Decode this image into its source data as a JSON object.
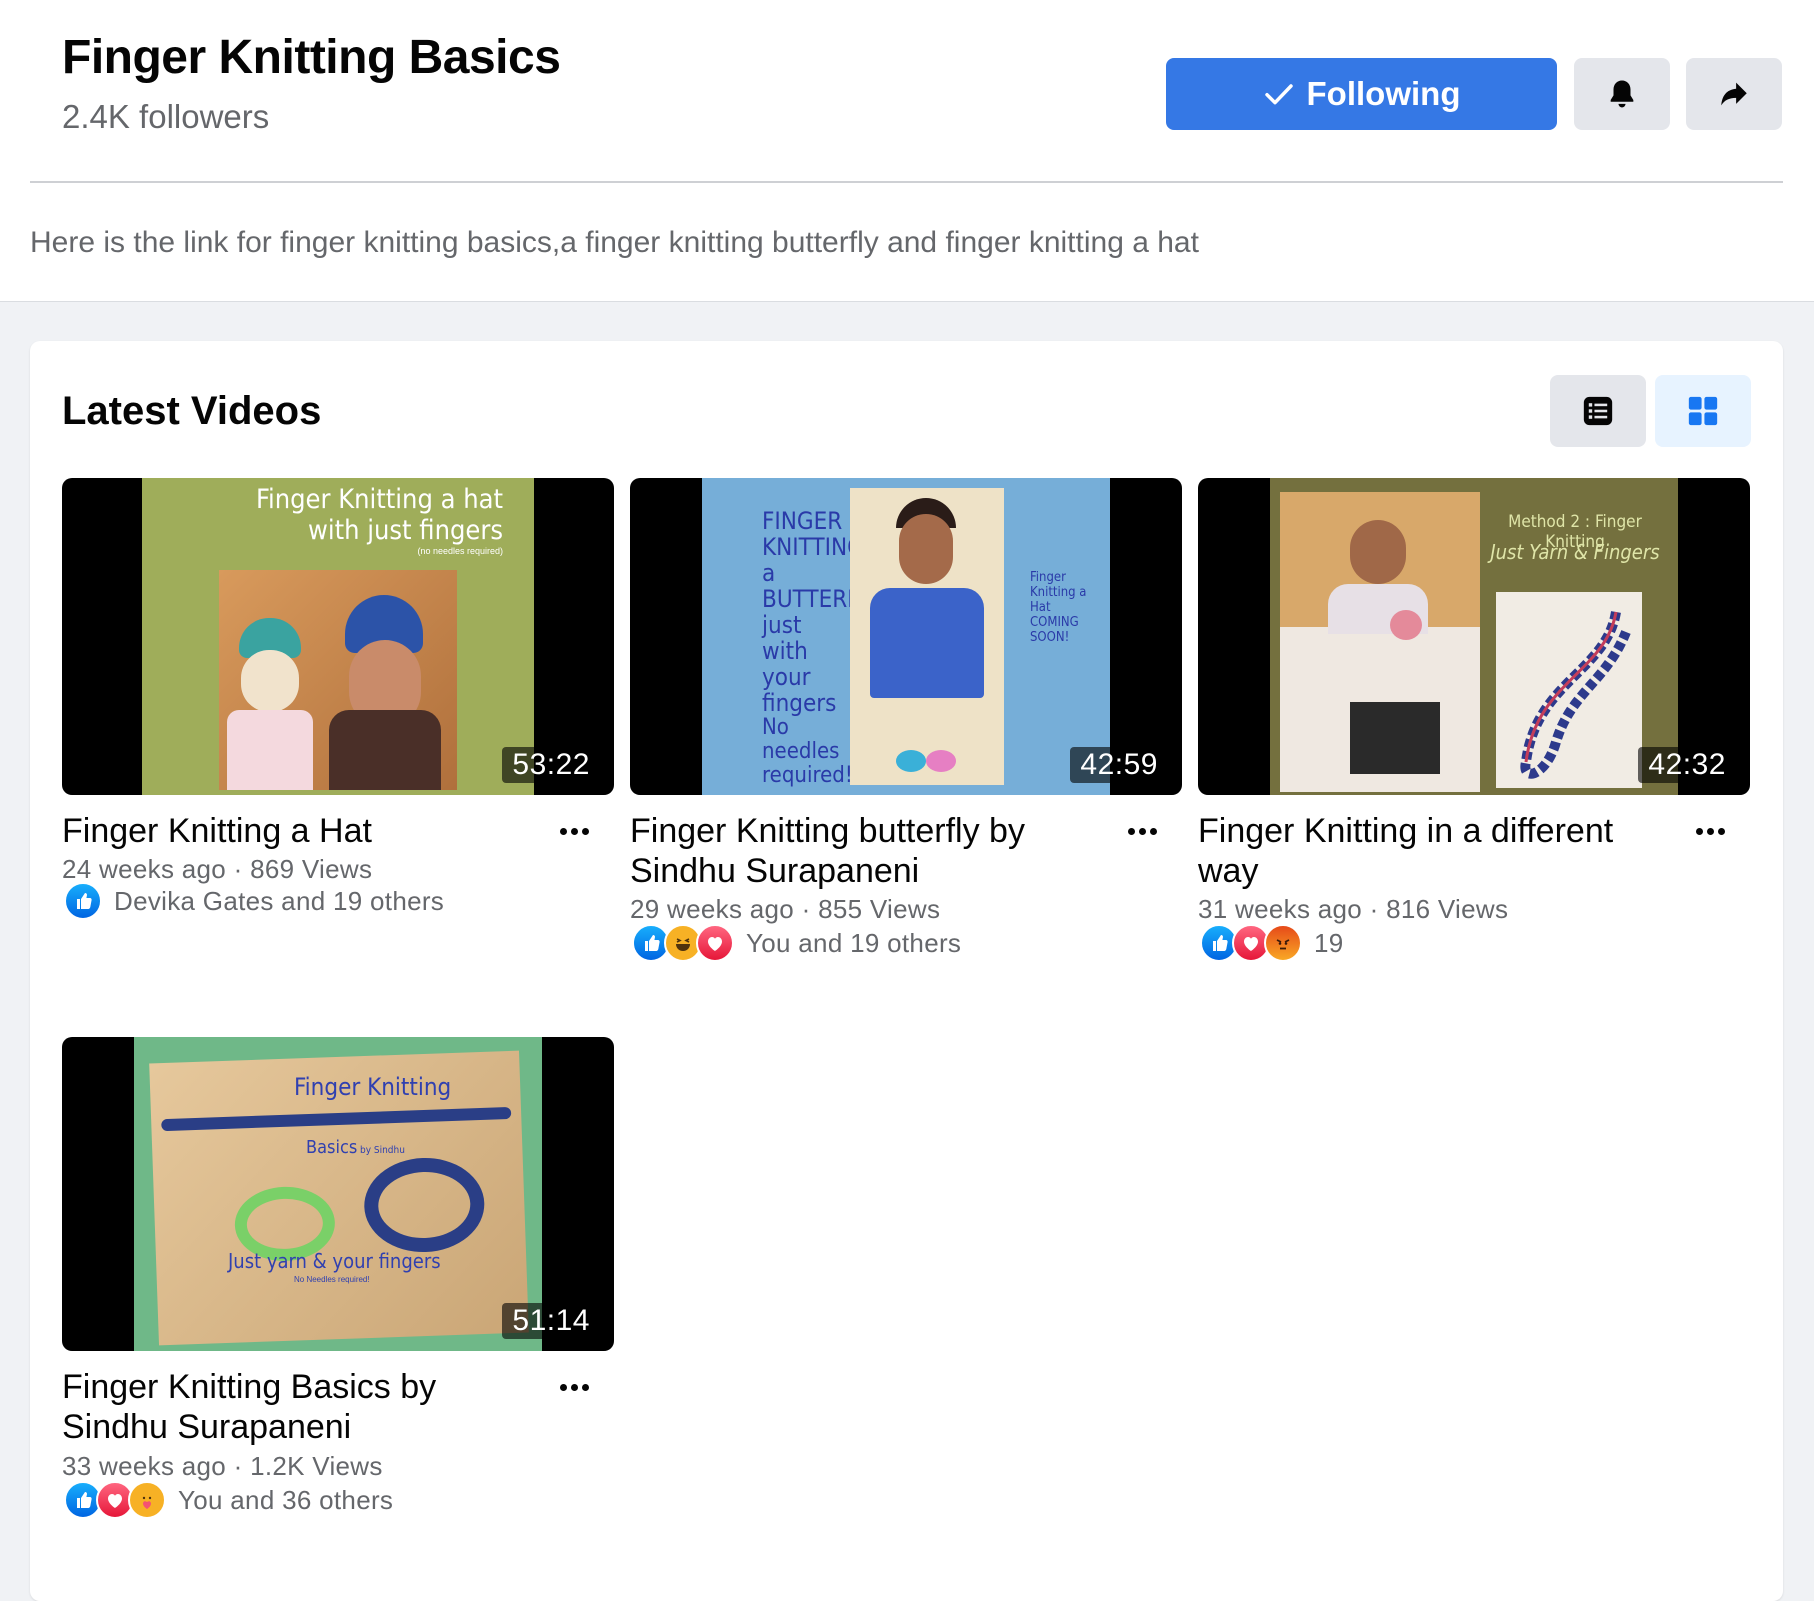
{
  "header": {
    "title": "Finger Knitting Basics",
    "followers": "2.4K followers",
    "following_label": "Following",
    "description": "Here is the link for finger knitting basics,a finger knitting butterfly and finger knitting a hat"
  },
  "section": {
    "title": "Latest Videos"
  },
  "videos": [
    {
      "title": "Finger Knitting a Hat",
      "duration": "53:22",
      "age": "24 weeks ago",
      "views": "869 Views",
      "reactions_label": "Devika Gates and 19 others",
      "reaction_icons": [
        "like-icon"
      ],
      "thumb_text": [
        "Finger Knitting a hat",
        "with just fingers",
        "(no needles required)"
      ]
    },
    {
      "title": "Finger Knitting butterfly by Sindhu Surapaneni",
      "duration": "42:59",
      "age": "29 weeks ago",
      "views": "855 Views",
      "reactions_label": "You and 19 others",
      "reaction_icons": [
        "like-icon",
        "haha-icon",
        "love-icon"
      ],
      "thumb_text": [
        "FINGER KNITTING a BUTTERFLY just with your fingers",
        "No needles required!",
        "Finger Knitting a Hat COMING SOON!"
      ]
    },
    {
      "title": "Finger Knitting in a different way",
      "duration": "42:32",
      "age": "31 weeks ago",
      "views": "816 Views",
      "reactions_label": "19",
      "reaction_icons": [
        "like-icon",
        "love-icon",
        "angry-icon"
      ],
      "thumb_text": [
        "Method 2 : Finger Knitting",
        "Just Yarn & Fingers"
      ]
    },
    {
      "title": "Finger Knitting Basics by Sindhu Surapaneni",
      "duration": "51:14",
      "age": "33 weeks ago",
      "views": "1.2K Views",
      "reactions_label": "You and 36 others",
      "reaction_icons": [
        "like-icon",
        "love-icon",
        "care-icon"
      ],
      "thumb_text": [
        "Finger Knitting",
        "Basics",
        "by Sindhu",
        "Just yarn & your fingers",
        "No Needles required!"
      ]
    }
  ],
  "colors": {
    "accent": "#3578e5",
    "secondary_text": "#65676b",
    "page_bg": "#f0f2f5"
  }
}
